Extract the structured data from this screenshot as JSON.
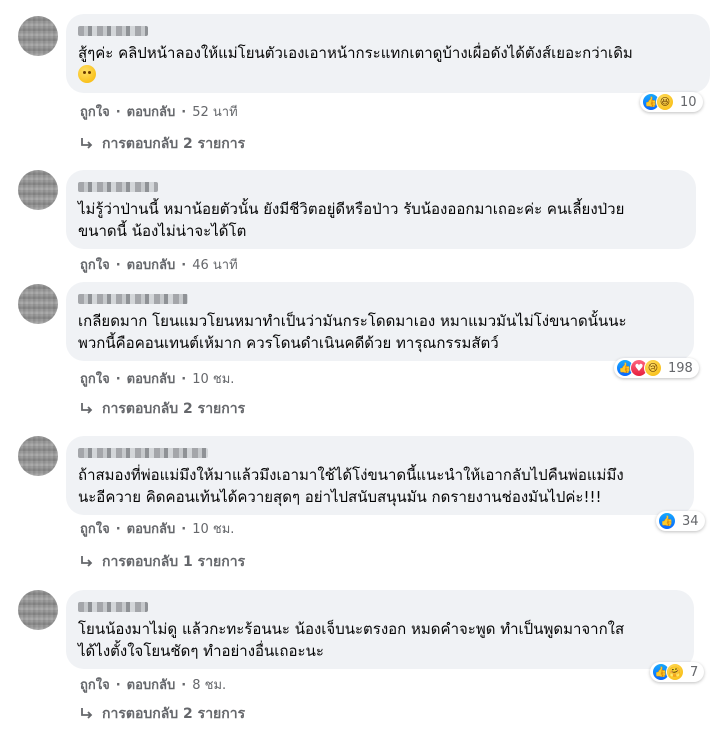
{
  "comments": [
    {
      "text": "สู้ๆค่ะ คลิปหน้าลองให้แม่โยนตัวเองเอาหน้ากระแทกเตาดูบ้างเผื่อดังได้ตังส์เยอะกว่าเดิม",
      "like": "ถูกใจ",
      "reply": "ตอบกลับ",
      "time": "52 นาที",
      "reaction_count": "10",
      "replies": "การตอบกลับ 2 รายการ"
    },
    {
      "text": "ไม่รู้ว่าป่านนี้ หมาน้อยตัวนั้น ยังมีชีวิตอยู่ดีหรือป่าว รับน้องออกมาเถอะค่ะ คนเลี้ยงป่วยขนาดนี้ น้องไม่น่าจะได้โต",
      "line1": "ไม่รู้ว่าป่านนี้ หมาน้อยตัวนั้น ยังมีชีวิตอยู่ดีหรือป่าว รับน้องออกมาเถอะค่ะ คนเลี้ยงป่วย",
      "line2": "ขนาดนี้ น้องไม่น่าจะได้โต",
      "like": "ถูกใจ",
      "reply": "ตอบกลับ",
      "time": "46 นาที"
    },
    {
      "line1": "เกลียดมาก โยนแมวโยนหมาทำเป็นว่ามันกระโดดมาเอง หมาแมวมันไม่โง่ขนาดนั้นนะ",
      "line2": "พวกนี้คือคอนเทนต์เห้มาก ควรโดนดำเนินคดีด้วย ทารุณกรรมสัตว์",
      "like": "ถูกใจ",
      "reply": "ตอบกลับ",
      "time": "10 ชม.",
      "reaction_count": "198",
      "replies": "การตอบกลับ 2 รายการ"
    },
    {
      "line1": "ถ้าสมองที่พ่อแม่มึงให้มาแล้วมึงเอามาใช้ได้โง่ขนาดนี้แนะนำให้เอากลับไปคืนพ่อแม่มึง",
      "line2": "นะอีควาย คิดคอนเท้นได้ควายสุดๆ อย่าไปสนับสนุนมัน กดรายงานช่องมันไปค่ะ!!!",
      "like": "ถูกใจ",
      "reply": "ตอบกลับ",
      "time": "10 ชม.",
      "reaction_count": "34",
      "replies": "การตอบกลับ 1 รายการ"
    },
    {
      "line1": "โยนน้องมาไม่ดู แล้วกะทะร้อนนะ น้องเจ็บนะตรงอก หมดคำจะพูด ทำเป็นพูดมาจากใส",
      "line2": "ได้ไงตั้งใจโยนชัดๆ ทำอย่างอื่นเถอะนะ",
      "like": "ถูกใจ",
      "reply": "ตอบกลับ",
      "time": "8 ชม.",
      "reaction_count": "7",
      "replies": "การตอบกลับ 2 รายการ"
    }
  ],
  "dot": "·",
  "colors": {
    "bubble": "#f0f2f5",
    "meta": "#65676b",
    "like_blue": "#0866ff"
  }
}
